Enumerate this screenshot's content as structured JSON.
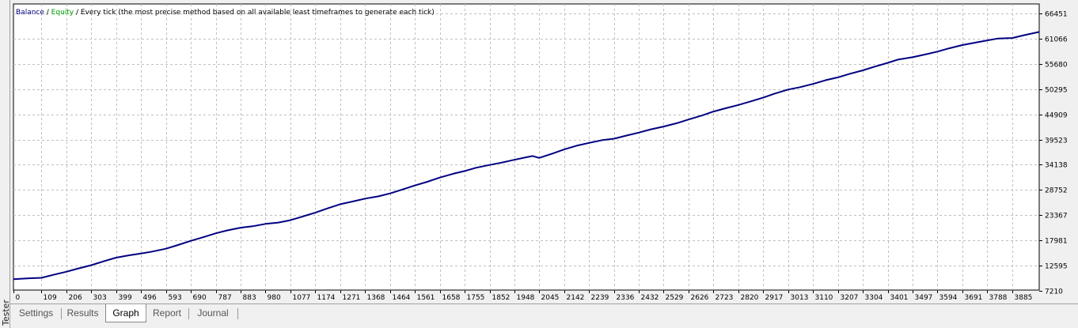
{
  "side_panel": {
    "label": "Tester"
  },
  "tabs": [
    {
      "label": "Settings",
      "active": false
    },
    {
      "label": "Results",
      "active": false
    },
    {
      "label": "Graph",
      "active": true
    },
    {
      "label": "Report",
      "active": false
    },
    {
      "label": "Journal",
      "active": false
    }
  ],
  "chart_data": {
    "type": "line",
    "legend": {
      "balance_label": "Balance",
      "sep1": " / ",
      "equity_label": "Equity",
      "sep2": " / ",
      "description": "Every tick (the most precise method based on all available least timeframes to generate each tick)"
    },
    "colors": {
      "balance": "#000080",
      "equity": "#00a000",
      "grid": "#c0c0c0",
      "background": "#ffffff"
    },
    "x_ticks": [
      0,
      109,
      206,
      303,
      399,
      496,
      593,
      690,
      787,
      883,
      980,
      1077,
      1174,
      1271,
      1368,
      1464,
      1561,
      1658,
      1755,
      1852,
      1948,
      2045,
      2142,
      2239,
      2336,
      2432,
      2529,
      2626,
      2723,
      2820,
      2917,
      3013,
      3110,
      3207,
      3304,
      3401,
      3497,
      3594,
      3691,
      3788,
      3885
    ],
    "y_ticks": [
      7210,
      12595,
      17981,
      23367,
      28752,
      34138,
      39523,
      44909,
      50295,
      55680,
      61066,
      66451
    ],
    "xlim": [
      0,
      3990
    ],
    "ylim": [
      7210,
      66451
    ],
    "grid": true,
    "series": [
      {
        "color": "#000080",
        "x": [
          0,
          60,
          109,
          160,
          206,
          250,
          303,
          350,
          399,
          450,
          496,
          540,
          593,
          640,
          690,
          740,
          787,
          830,
          883,
          930,
          980,
          1030,
          1077,
          1120,
          1174,
          1220,
          1271,
          1320,
          1368,
          1420,
          1464,
          1510,
          1561,
          1610,
          1658,
          1710,
          1755,
          1800,
          1852,
          1900,
          1948,
          2000,
          2020,
          2045,
          2100,
          2142,
          2190,
          2239,
          2290,
          2336,
          2380,
          2432,
          2480,
          2529,
          2580,
          2626,
          2680,
          2723,
          2770,
          2820,
          2870,
          2917,
          2960,
          3013,
          3060,
          3110,
          3160,
          3207,
          3250,
          3304,
          3350,
          3401,
          3440,
          3497,
          3540,
          3594,
          3640,
          3691,
          3740,
          3788,
          3830,
          3885,
          3930,
          3990
        ],
        "y": [
          9700,
          9900,
          10000,
          10700,
          11300,
          11950,
          12700,
          13500,
          14300,
          14800,
          15200,
          15600,
          16200,
          17000,
          17900,
          18700,
          19500,
          20100,
          20700,
          21000,
          21500,
          21800,
          22300,
          23000,
          23900,
          24800,
          25700,
          26300,
          26900,
          27400,
          28000,
          28800,
          29700,
          30500,
          31400,
          32200,
          32800,
          33500,
          34100,
          34600,
          35200,
          35800,
          36000,
          35600,
          36600,
          37400,
          38200,
          38800,
          39400,
          39700,
          40300,
          41000,
          41700,
          42300,
          43000,
          43800,
          44700,
          45500,
          46200,
          46900,
          47700,
          48500,
          49300,
          50200,
          50700,
          51400,
          52200,
          52800,
          53500,
          54300,
          55100,
          55900,
          56600,
          57100,
          57600,
          58300,
          59000,
          59700,
          60200,
          60700,
          61100,
          61200,
          61800,
          62500
        ]
      }
    ]
  }
}
